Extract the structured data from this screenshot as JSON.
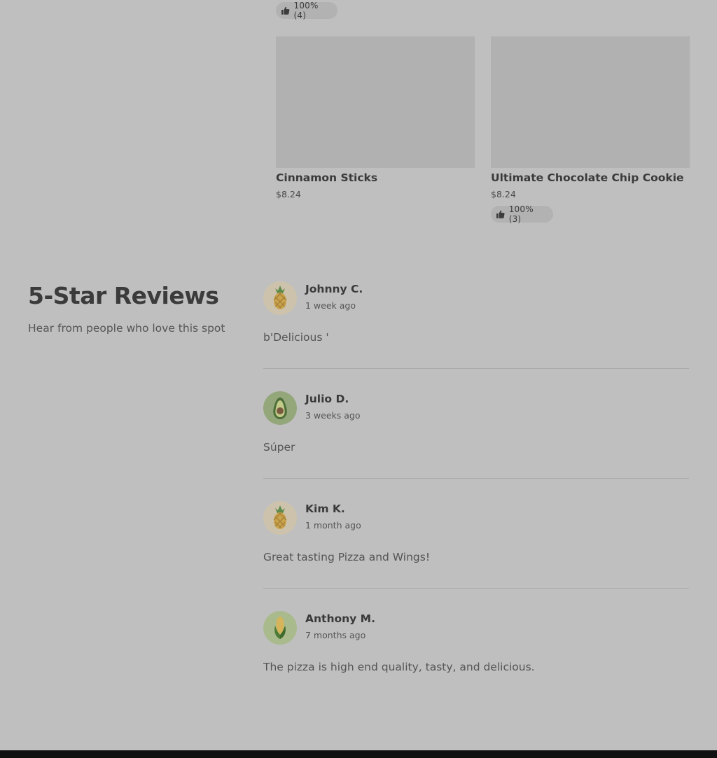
{
  "top_rating": {
    "text": "100% (4)"
  },
  "products": [
    {
      "name": "Cinnamon Sticks",
      "price": "$8.24",
      "rating": ""
    },
    {
      "name": "Ultimate Chocolate Chip Cookie",
      "price": "$8.24",
      "rating": "100% (3)"
    }
  ],
  "reviews_section": {
    "title": "5-Star Reviews",
    "subtitle": "Hear from people who love this spot"
  },
  "reviews": [
    {
      "name": "Johnny C.",
      "time": "1 week ago",
      "text": "b'Delicious '",
      "avatar_icon": "pineapple-icon"
    },
    {
      "name": "Julio D.",
      "time": "3 weeks ago",
      "text": "Súper",
      "avatar_icon": "avocado-icon"
    },
    {
      "name": "Kim K.",
      "time": "1 month ago",
      "text": "Great tasting Pizza and Wings!",
      "avatar_icon": "pineapple-icon"
    },
    {
      "name": "Anthony M.",
      "time": "7 months ago",
      "text": "The pizza is high end quality, tasty, and delicious.",
      "avatar_icon": "corn-icon"
    }
  ],
  "colors": {
    "overlay_background": "#bfbfbf",
    "placeholder_image": "#b1b1b1",
    "footer": "#111111"
  }
}
